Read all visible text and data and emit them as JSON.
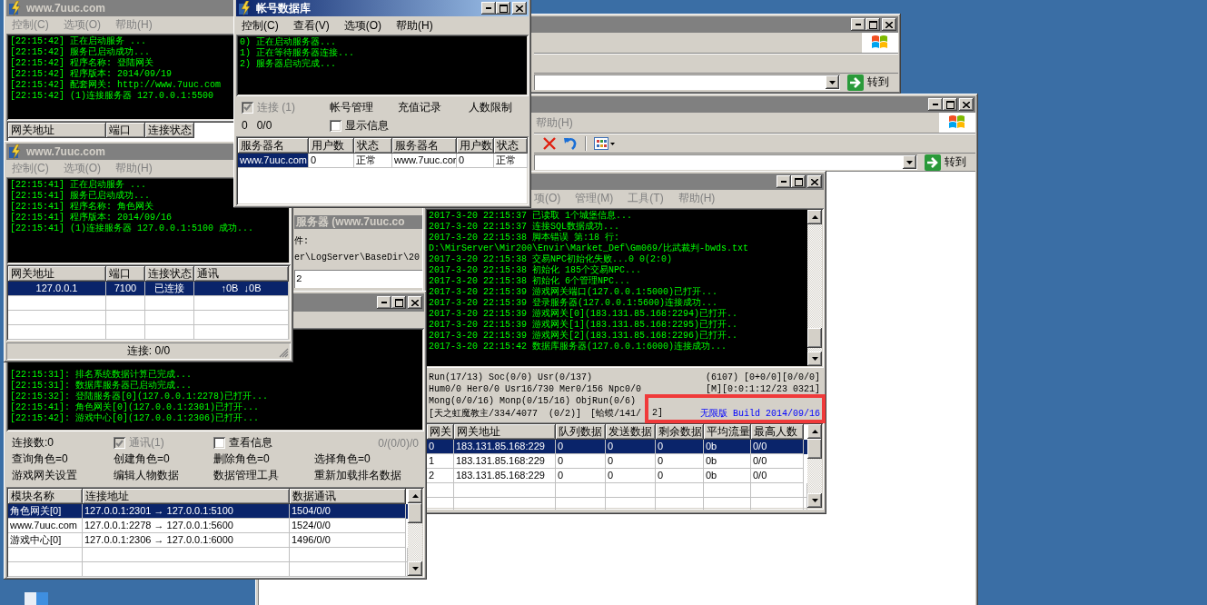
{
  "windows": [
    {
      "kind": "gateway",
      "active": false,
      "title": "www.7uuc.com",
      "menu": [
        "控制(C)",
        "选项(O)",
        "帮助(H)"
      ],
      "log": [
        "[22:15:42] 正在启动服务 ...",
        "[22:15:42] 服务已启动成功...",
        "[22:15:42] 程序名称: 登陆网关",
        "[22:15:42] 程序版本: 2014/09/19",
        "[22:15:42] 配套网关: http://www.7uuc.com",
        "[22:15:42] (1)连接服务器 127.0.0.1:5500"
      ],
      "table": {
        "columns": [
          "网关地址",
          "端口",
          "连接状态"
        ]
      }
    },
    {
      "kind": "account_db",
      "active": true,
      "caption_buttons": true,
      "title": "帐号数据库",
      "menu": [
        "控制(C)",
        "查看(V)",
        "选项(O)",
        "帮助(H)"
      ],
      "log": [
        "0) 正在启动服务器...",
        "1) 正在等待服务器连接...",
        "2) 服务器启动完成..."
      ],
      "connect": {
        "label": "连接 (1)",
        "checked": true,
        "disabled": true
      },
      "actions": [
        "帐号管理",
        "充值记录",
        "人数限制"
      ],
      "counters": [
        "0",
        "0/0"
      ],
      "show_info": {
        "label": "显示信息",
        "checked": false,
        "disabled": false
      },
      "table": {
        "columns": [
          "服务器名",
          "用户数",
          "状态",
          "服务器名",
          "用户数",
          "状态"
        ],
        "rows": [
          {
            "cells": [
              "www.7uuc.com",
              "0",
              "正常",
              "www.7uuc.cor",
              "0",
              "正常"
            ],
            "selected": true
          }
        ]
      }
    },
    {
      "kind": "browser",
      "active": false,
      "caption_buttons": true,
      "toolbar_icons": false,
      "go_label": "转到"
    },
    {
      "kind": "browser",
      "active": false,
      "caption_buttons": true,
      "menu": [
        "帮助(H)"
      ],
      "toolbar_icons": true,
      "go_label": "转到"
    },
    {
      "kind": "gateway",
      "active": false,
      "title": "www.7uuc.com",
      "menu": [
        "控制(C)",
        "选项(O)",
        "帮助(H)"
      ],
      "log": [
        "[22:15:41] 正在启动服务 ...",
        "[22:15:41] 服务已启动成功...",
        "[22:15:41] 程序名称: 角色网关",
        "[22:15:41] 程序版本: 2014/09/16",
        "[22:15:41] (1)连接服务器 127.0.0.1:5100 成功..."
      ],
      "table": {
        "columns": [
          "网关地址",
          "端口",
          "连接状态",
          "通讯"
        ],
        "rows": [
          {
            "cells": [
              "127.0.0.1",
              "7100",
              "已连接",
              "↑0B  ↓0B"
            ],
            "selected": true
          }
        ]
      },
      "status": "连接: 0/0"
    },
    {
      "kind": "m2_server",
      "active": false,
      "caption_buttons": true,
      "menu": [
        "项(O)",
        "管理(M)",
        "工具(T)",
        "帮助(H)"
      ],
      "log": [
        "2017-3-20 22:15:37 已读取 1个城堡信息...",
        "2017-3-20 22:15:37 连接SQL数据成功...",
        "2017-3-20 22:15:38 脚本错误 第:18 行:",
        "D:\\MirServer\\Mir200\\Envir\\Market_Def\\Gm069/比武裁判-bwds.txt",
        "2017-3-20 22:15:38 交易NPC初始化失败...0 0(2:0)",
        "2017-3-20 22:15:38 初始化 185个交易NPC...",
        "2017-3-20 22:15:38 初始化 6个管理NPC...",
        "2017-3-20 22:15:39 游戏网关端口(127.0.0.1:5000)已打开...",
        "2017-3-20 22:15:39 登录服务器(127.0.0.1:5600)连接成功...",
        "2017-3-20 22:15:39 游戏网关[0](183.131.85.168:2294)已打开..",
        "2017-3-20 22:15:39 游戏网关[1](183.131.85.168:2295)已打开..",
        "2017-3-20 22:15:39 游戏网关[2](183.131.85.168:2296)已打开..",
        "2017-3-20 22:15:42 数据库服务器(127.0.0.1:6000)连接成功..."
      ],
      "status_lines": [
        {
          "texts": [
            "Run(17/13) Soc(0/0) Usr(0/137)"
          ],
          "right": "(6107) [0+0/0][0/0/0]"
        },
        {
          "texts": [
            "Hum0/0 Her0/0 Usr16/730 Mer0/156 Npc0/0"
          ],
          "right": "[M][0:0:1:12/23 0321]"
        },
        {
          "texts": [
            "Mong(0/0/16) Monp(0/15/16) ObjRun(0/6)"
          ]
        },
        {
          "texts": [
            "[天之虹魔教主/334/4077  (0/2)]",
            "[蛤蟆/141/"
          ],
          "highlighted": [
            "2]"
          ],
          "link": "无限版 Build 2014/09/16"
        }
      ],
      "table": {
        "columns": [
          "网关",
          "网关地址",
          "队列数据",
          "发送数据",
          "剩余数据",
          "平均流量",
          "最高人数"
        ],
        "rows": [
          {
            "cells": [
              "0",
              "183.131.85.168:229",
              "0",
              "0",
              "0",
              "0b",
              "0/0"
            ],
            "selected": true
          },
          {
            "cells": [
              "1",
              "183.131.85.168:229",
              "0",
              "0",
              "0",
              "0b",
              "0/0"
            ],
            "selected": false
          },
          {
            "cells": [
              "2",
              "183.131.85.168:229",
              "0",
              "0",
              "0",
              "0b",
              "0/0"
            ],
            "selected": false
          }
        ]
      }
    },
    {
      "kind": "log_server",
      "active": false,
      "title": "服务器 (www.7uuc.co",
      "file_label": "件:",
      "path": "er\\LogServer\\BaseDir\\20",
      "field_value": "2"
    },
    {
      "kind": "game_console",
      "active": false,
      "caption_buttons": true,
      "log": [
        "[22:15:31]: 排名系统数据计算已完成...",
        "[22:15:31]: 数据库服务器已启动完成...",
        "[22:15:32]: 登陆服务器[0](127.0.0.1:2278)已打开...",
        "[22:15:41]: 角色网关[0](127.0.0.1:2301)已打开...",
        "[22:15:42]: 游戏中心[0](127.0.0.1:2306)已打开..."
      ],
      "connections": "连接数:0",
      "checkboxes": [
        {
          "label": "通讯(1)",
          "checked": true,
          "disabled": true
        },
        {
          "label": "查看信息",
          "checked": false,
          "disabled": false
        }
      ],
      "counter": "0/(0/0)/0",
      "counts": [
        "查询角色=0",
        "创建角色=0",
        "删除角色=0",
        "选择角色=0"
      ],
      "actions": [
        "游戏网关设置",
        "编辑人物数据",
        "数据管理工具",
        "重新加载排名数据"
      ],
      "table": {
        "columns": [
          "模块名称",
          "连接地址",
          "数据通讯"
        ],
        "rows": [
          {
            "cells": [
              "角色网关[0]",
              "127.0.0.1:2301 → 127.0.0.1:5100",
              "1504/0/0"
            ],
            "selected": true
          },
          {
            "cells": [
              "www.7uuc.com",
              "127.0.0.1:2278 → 127.0.0.1:5600",
              "1524/0/0"
            ],
            "selected": false
          },
          {
            "cells": [
              "游戏中心[0]",
              "127.0.0.1:2306 → 127.0.0.1:6000",
              "1496/0/0"
            ],
            "selected": false
          }
        ]
      }
    }
  ]
}
